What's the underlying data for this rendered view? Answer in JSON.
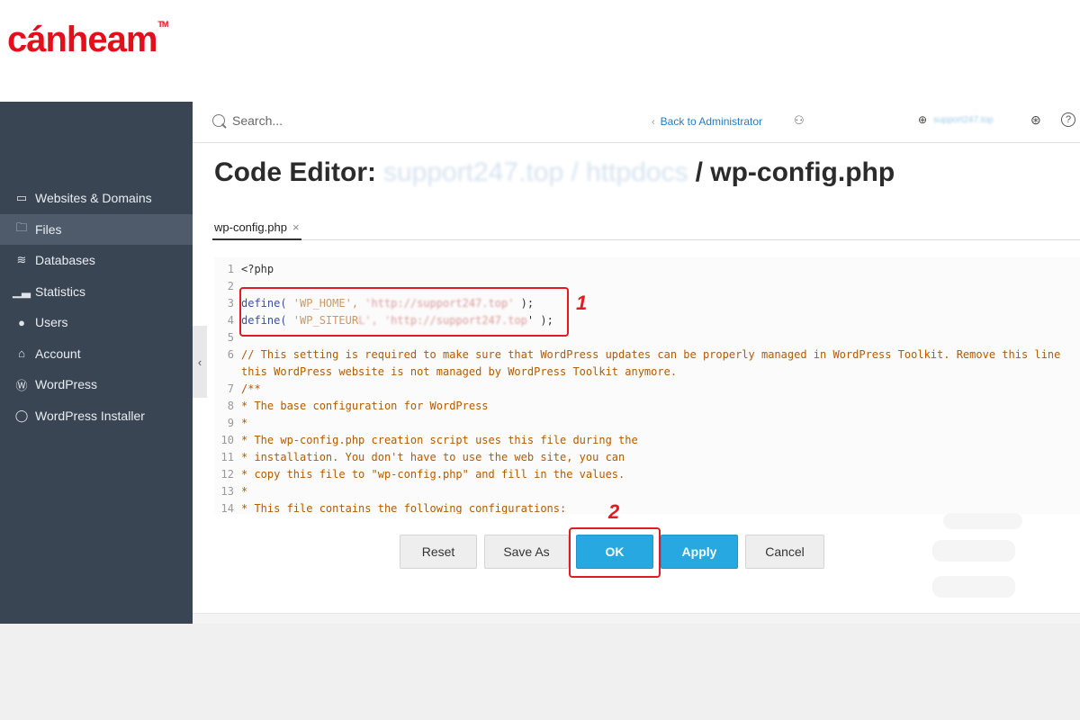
{
  "brand": {
    "logo_text": "cánheam",
    "logo_tm": "TM"
  },
  "sidebar": {
    "items": [
      {
        "label": "Websites & Domains",
        "icon": "monitor-icon",
        "active": false
      },
      {
        "label": "Files",
        "icon": "folder-icon",
        "active": true
      },
      {
        "label": "Databases",
        "icon": "database-icon",
        "active": false
      },
      {
        "label": "Statistics",
        "icon": "bar-chart-icon",
        "active": false
      },
      {
        "label": "Users",
        "icon": "user-icon",
        "active": false
      },
      {
        "label": "Account",
        "icon": "account-icon",
        "active": false
      },
      {
        "label": "WordPress",
        "icon": "wordpress-icon",
        "active": false
      },
      {
        "label": "WordPress Installer",
        "icon": "wordpress-installer-icon",
        "active": false
      }
    ],
    "collapse_glyph": "‹"
  },
  "topbar": {
    "search_placeholder": "Search...",
    "back_link": "Back to Administrator",
    "domain": "support247.top"
  },
  "page": {
    "title_prefix": "Code Editor:",
    "title_path": "support247.top / httpdocs",
    "title_file": "/ wp-config.php"
  },
  "tab": {
    "label": "wp-config.php",
    "close": "×"
  },
  "editor": {
    "lines": [
      {
        "n": "1",
        "text": "<?php"
      },
      {
        "n": "2",
        "text": ""
      },
      {
        "n": "3",
        "kw": "define(",
        "name": " 'WP_HOME',",
        "val": " 'http://support247.top'",
        "end": " );"
      },
      {
        "n": "4",
        "kw": "define(",
        "name": " 'WP_SITEUR",
        "val": "L', 'http://support247.top",
        "end": "' );"
      },
      {
        "n": "5",
        "text": ""
      },
      {
        "n": "6",
        "comment": "// This setting is required to make sure that WordPress updates can be properly managed in WordPress Toolkit. Remove this line"
      },
      {
        "n": "",
        "comment": "this WordPress website is not managed by WordPress Toolkit anymore."
      },
      {
        "n": "7",
        "comment": "/**"
      },
      {
        "n": "8",
        "comment": " * The base configuration for WordPress"
      },
      {
        "n": "9",
        "comment": " *"
      },
      {
        "n": "10",
        "comment": " * The wp-config.php creation script uses this file during the"
      },
      {
        "n": "11",
        "comment": " * installation. You don't have to use the web site, you can"
      },
      {
        "n": "12",
        "comment": " * copy this file to \"wp-config.php\" and fill in the values."
      },
      {
        "n": "13",
        "comment": " *"
      },
      {
        "n": "14",
        "comment": " * This file contains the following configurations:"
      }
    ]
  },
  "annotations": {
    "step1": "1",
    "step2": "2"
  },
  "buttons": {
    "reset": "Reset",
    "save_as": "Save As",
    "ok": "OK",
    "apply": "Apply",
    "cancel": "Cancel"
  },
  "colors": {
    "accent_red": "#e21b22",
    "primary_blue": "#28a8e0",
    "sidebar_bg": "#3a4553"
  }
}
